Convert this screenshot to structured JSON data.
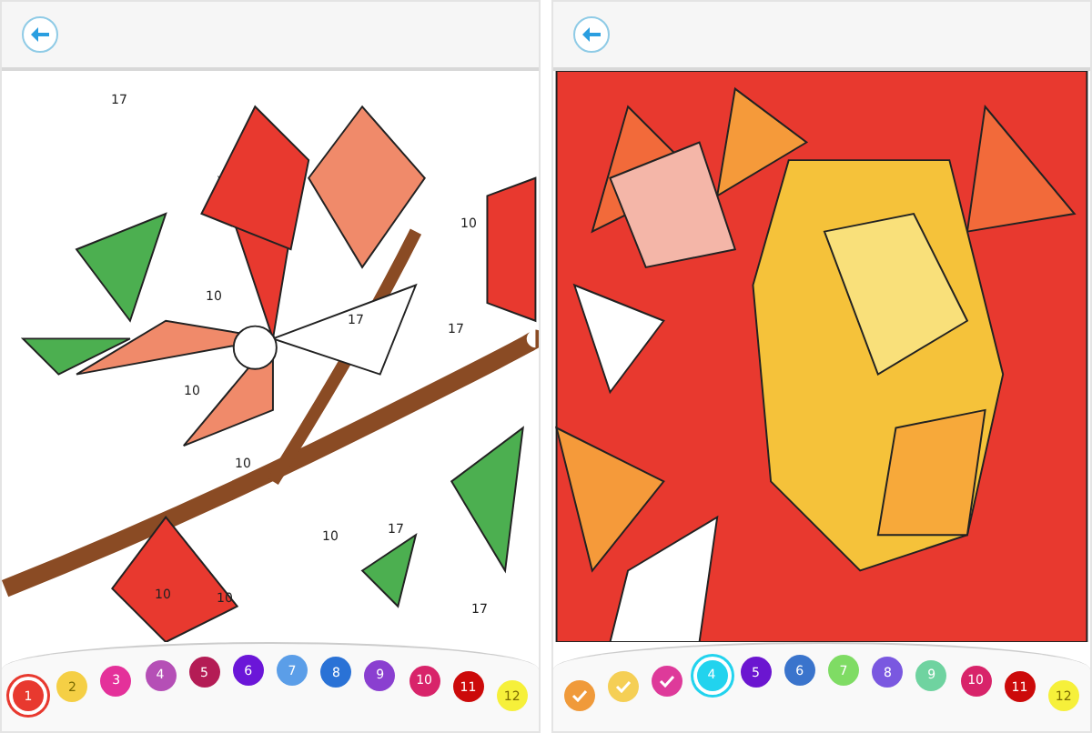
{
  "panels": [
    {
      "canvas": {
        "kind": "flower",
        "labels": [
          "17",
          "10",
          "10",
          "10",
          "10",
          "17",
          "10",
          "17",
          "17",
          "10",
          "10",
          "17"
        ]
      },
      "palette": [
        {
          "label": "1",
          "color": "#e8392f",
          "selected": true,
          "done": false
        },
        {
          "label": "2",
          "color": "#f5cf45",
          "selected": false,
          "done": false
        },
        {
          "label": "3",
          "color": "#e4319a",
          "selected": false,
          "done": false
        },
        {
          "label": "4",
          "color": "#b54fb6",
          "selected": false,
          "done": false
        },
        {
          "label": "5",
          "color": "#b41c55",
          "selected": false,
          "done": false
        },
        {
          "label": "6",
          "color": "#6b16d8",
          "selected": false,
          "done": false
        },
        {
          "label": "7",
          "color": "#5b9ee8",
          "selected": false,
          "done": false
        },
        {
          "label": "8",
          "color": "#2a72d6",
          "selected": false,
          "done": false
        },
        {
          "label": "9",
          "color": "#8a3fd0",
          "selected": false,
          "done": false
        },
        {
          "label": "10",
          "color": "#d8246a",
          "selected": false,
          "done": false
        },
        {
          "label": "11",
          "color": "#cc0a0a",
          "selected": false,
          "done": false
        },
        {
          "label": "12",
          "color": "#f6f03a",
          "selected": false,
          "done": false
        }
      ]
    },
    {
      "canvas": {
        "kind": "lion"
      },
      "palette": [
        {
          "color": "#f09a3a",
          "selected": false,
          "done": true
        },
        {
          "color": "#f5cf55",
          "selected": false,
          "done": true
        },
        {
          "color": "#de3a9a",
          "selected": false,
          "done": true
        },
        {
          "label": "4",
          "color": "#22d3ee",
          "selected": true,
          "done": false
        },
        {
          "label": "5",
          "color": "#6b16d0",
          "selected": false,
          "done": false
        },
        {
          "label": "6",
          "color": "#3a74cc",
          "selected": false,
          "done": false
        },
        {
          "label": "7",
          "color": "#7fdc64",
          "selected": false,
          "done": false
        },
        {
          "label": "8",
          "color": "#7a58e0",
          "selected": false,
          "done": false
        },
        {
          "label": "9",
          "color": "#6fd3a0",
          "selected": false,
          "done": false
        },
        {
          "label": "10",
          "color": "#d8246a",
          "selected": false,
          "done": false
        },
        {
          "label": "11",
          "color": "#cc0a0a",
          "selected": false,
          "done": false
        },
        {
          "label": "12",
          "color": "#f6f03a",
          "selected": false,
          "done": false
        }
      ]
    }
  ]
}
